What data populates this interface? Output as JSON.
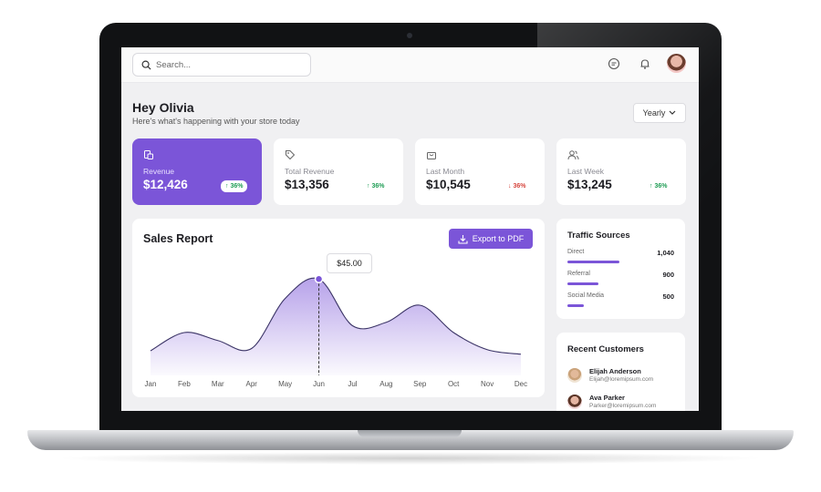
{
  "header": {
    "search_placeholder": "Search...",
    "icons": [
      "search-icon",
      "chat-icon",
      "bell-icon",
      "avatar"
    ]
  },
  "greeting": {
    "title": "Hey Olivia",
    "subtitle": "Here's what's happening with your store today"
  },
  "filter": {
    "selected": "Yearly"
  },
  "stats": [
    {
      "label": "Revenue",
      "value": "$12,426",
      "change": "36%",
      "direction": "up",
      "icon": "coins-icon",
      "highlight": true
    },
    {
      "label": "Total Revenue",
      "value": "$13,356",
      "change": "36%",
      "direction": "up",
      "icon": "tag-icon",
      "highlight": false
    },
    {
      "label": "Last Month",
      "value": "$10,545",
      "change": "36%",
      "direction": "down",
      "icon": "bag-icon",
      "highlight": false
    },
    {
      "label": "Last Week",
      "value": "$13,245",
      "change": "36%",
      "direction": "up",
      "icon": "users-icon",
      "highlight": false
    }
  ],
  "sales_report": {
    "title": "Sales Report",
    "export_label": "Export to PDF",
    "tooltip": "$45.00"
  },
  "chart_data": {
    "type": "area",
    "categories": [
      "Jan",
      "Feb",
      "Mar",
      "Apr",
      "May",
      "Jun",
      "Jul",
      "Aug",
      "Sep",
      "Oct",
      "Nov",
      "Dec"
    ],
    "values": [
      12,
      28,
      21,
      14,
      58,
      75,
      34,
      37,
      52,
      28,
      13,
      9
    ],
    "highlight_category": "Jun",
    "color": "#7b55d8"
  },
  "traffic": {
    "title": "Traffic Sources",
    "items": [
      {
        "name": "Direct",
        "value": "1,040",
        "fraction": 0.49
      },
      {
        "name": "Referral",
        "value": "900",
        "fraction": 0.29
      },
      {
        "name": "Social Media",
        "value": "500",
        "fraction": 0.15
      }
    ]
  },
  "customers": {
    "title": "Recent Customers",
    "items": [
      {
        "name": "Elijah Anderson",
        "email": "Elijah@loremipsum.com"
      },
      {
        "name": "Ava Parker",
        "email": "Parker@loremipsum.com"
      }
    ]
  },
  "colors": {
    "accent": "#7b55d8",
    "up": "#1f9d55",
    "down": "#d6453d"
  }
}
